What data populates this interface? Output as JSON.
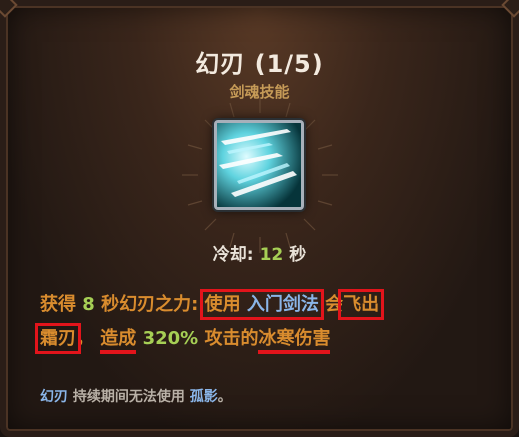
{
  "skill": {
    "name": "幻刃 (1/5)",
    "category": "剑魂技能",
    "icon": "ice-blade-icon",
    "cooldown_label": "冷却:",
    "cooldown_value": "12",
    "cooldown_unit": "秒"
  },
  "description": {
    "p1": "获得",
    "duration": "8",
    "p2": "秒幻刃之力:",
    "use": "使用",
    "skill_ref": "入门剑法",
    "p3": "会",
    "fly1": "飞出",
    "fly2": "霜刃",
    "comma": "，",
    "deal": "造成",
    "percent": "320%",
    "p4": "攻击的",
    "damage": "冰寒伤害"
  },
  "footer": {
    "name_ref": "幻刃",
    "text": "持续期间无法使用",
    "blocked_ref": "孤影",
    "end": "。"
  },
  "colors": {
    "title": "#f3eadf",
    "category": "#c59a57",
    "description": "#d98c2e",
    "number": "#a6cf55",
    "reference": "#8ab5e8",
    "highlight": "#e2141b"
  }
}
